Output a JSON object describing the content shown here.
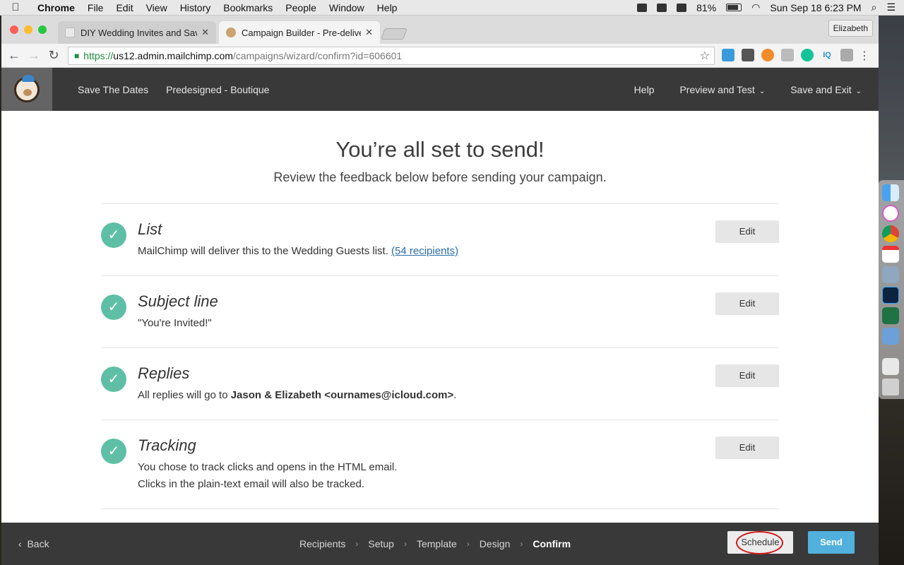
{
  "menubar": {
    "app": "Chrome",
    "items": [
      "File",
      "Edit",
      "View",
      "History",
      "Bookmarks",
      "People",
      "Window",
      "Help"
    ],
    "battery": "81%",
    "datetime": "Sun Sep 18  6:23 PM"
  },
  "tabs": [
    {
      "title": "DIY Wedding Invites and Save",
      "active": false
    },
    {
      "title": "Campaign Builder - Pre-deliver",
      "active": true
    }
  ],
  "profile": "Elizabeth",
  "address": {
    "scheme": "https://",
    "host": "us12.admin.mailchimp.com",
    "path": "/campaigns/wizard/confirm?id=606601"
  },
  "mc_header": {
    "campaign_name": "Save The Dates",
    "template_name": "Predesigned - Boutique",
    "help": "Help",
    "preview": "Preview and Test",
    "save_exit": "Save and Exit"
  },
  "hero": {
    "title": "You’re all set to send!",
    "subtitle": "Review the feedback below before sending your campaign."
  },
  "sections": {
    "list": {
      "title": "List",
      "desc": "MailChimp will deliver this to the Wedding Guests list. ",
      "link": "(54 recipients)",
      "edit": "Edit"
    },
    "subject": {
      "title": "Subject line",
      "desc": "\"You're Invited!\"",
      "edit": "Edit"
    },
    "replies": {
      "title": "Replies",
      "desc_prefix": "All replies will go to ",
      "desc_strong": "Jason & Elizabeth <ournames@icloud.com>",
      "desc_suffix": ".",
      "edit": "Edit"
    },
    "tracking": {
      "title": "Tracking",
      "line1": "You chose to track clicks and opens in the HTML email.",
      "line2": "Clicks in the plain-text email will also be tracked.",
      "edit": "Edit"
    }
  },
  "footer": {
    "back": "Back",
    "steps": [
      "Recipients",
      "Setup",
      "Template",
      "Design",
      "Confirm"
    ],
    "current_step": "Confirm",
    "schedule": "Schedule",
    "send": "Send"
  },
  "colors": {
    "check": "#5ebfa6",
    "send": "#52b0dd",
    "header_bg": "#393939",
    "annotation": "#d21a1a"
  }
}
